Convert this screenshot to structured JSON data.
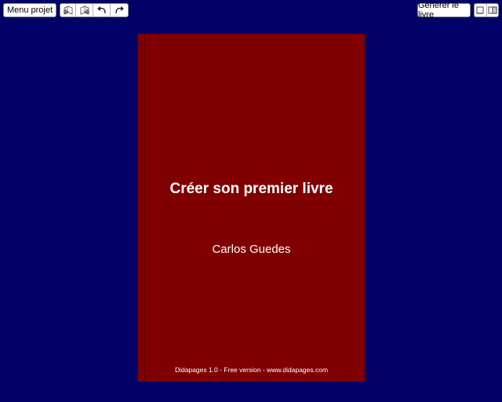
{
  "toolbar": {
    "menu_label": "Menu projet",
    "generate_label": "Générer le livre",
    "tools": [
      {
        "icon": "previous-page-icon"
      },
      {
        "icon": "next-page-icon"
      },
      {
        "icon": "undo-icon"
      },
      {
        "icon": "redo-icon"
      }
    ],
    "view_buttons": [
      {
        "icon": "single-page-view-icon"
      },
      {
        "icon": "open-book-view-icon"
      }
    ]
  },
  "book": {
    "title": "Créer son premier livre",
    "author": "Carlos Guedes",
    "footer": "Didapages 1.0 - Free version - www.didapages.com",
    "cover_color": "#800000"
  },
  "colors": {
    "background": "#000066",
    "button_bg": "#ffffff"
  }
}
